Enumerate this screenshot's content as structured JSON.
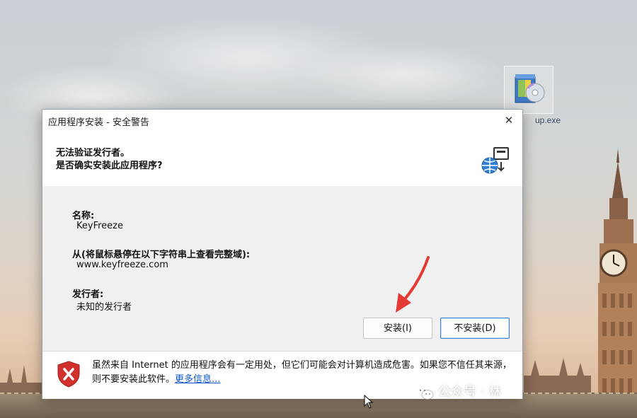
{
  "desktop": {
    "icon_label": "up.exe"
  },
  "dialog": {
    "title": "应用程序安装 - 安全警告",
    "close_glyph": "✕",
    "heading_line1": "无法验证发行者。",
    "heading_line2": "是否确实安装此应用程序?",
    "fields": {
      "name_label": "名称:",
      "name_value": "KeyFreeze",
      "from_label": "从(将鼠标悬停在以下字符串上查看完整域):",
      "from_value": "www.keyfreeze.com",
      "publisher_label": "发行者:",
      "publisher_value": "未知的发行者"
    },
    "buttons": {
      "install": "安装(I)",
      "cancel": "不安装(D)"
    },
    "footer": {
      "warning_text": "虽然来自 Internet 的应用程序会有一定用处，但它们可能会对计算机造成危害。如果您不信任其来源，则不要安装此软件。",
      "more_info_link": "更多信息..."
    }
  },
  "watermark": {
    "text": "公众号 · 林"
  },
  "colors": {
    "link": "#0b57d0",
    "shield_red": "#d0312d",
    "arrow_red": "#e53935"
  }
}
